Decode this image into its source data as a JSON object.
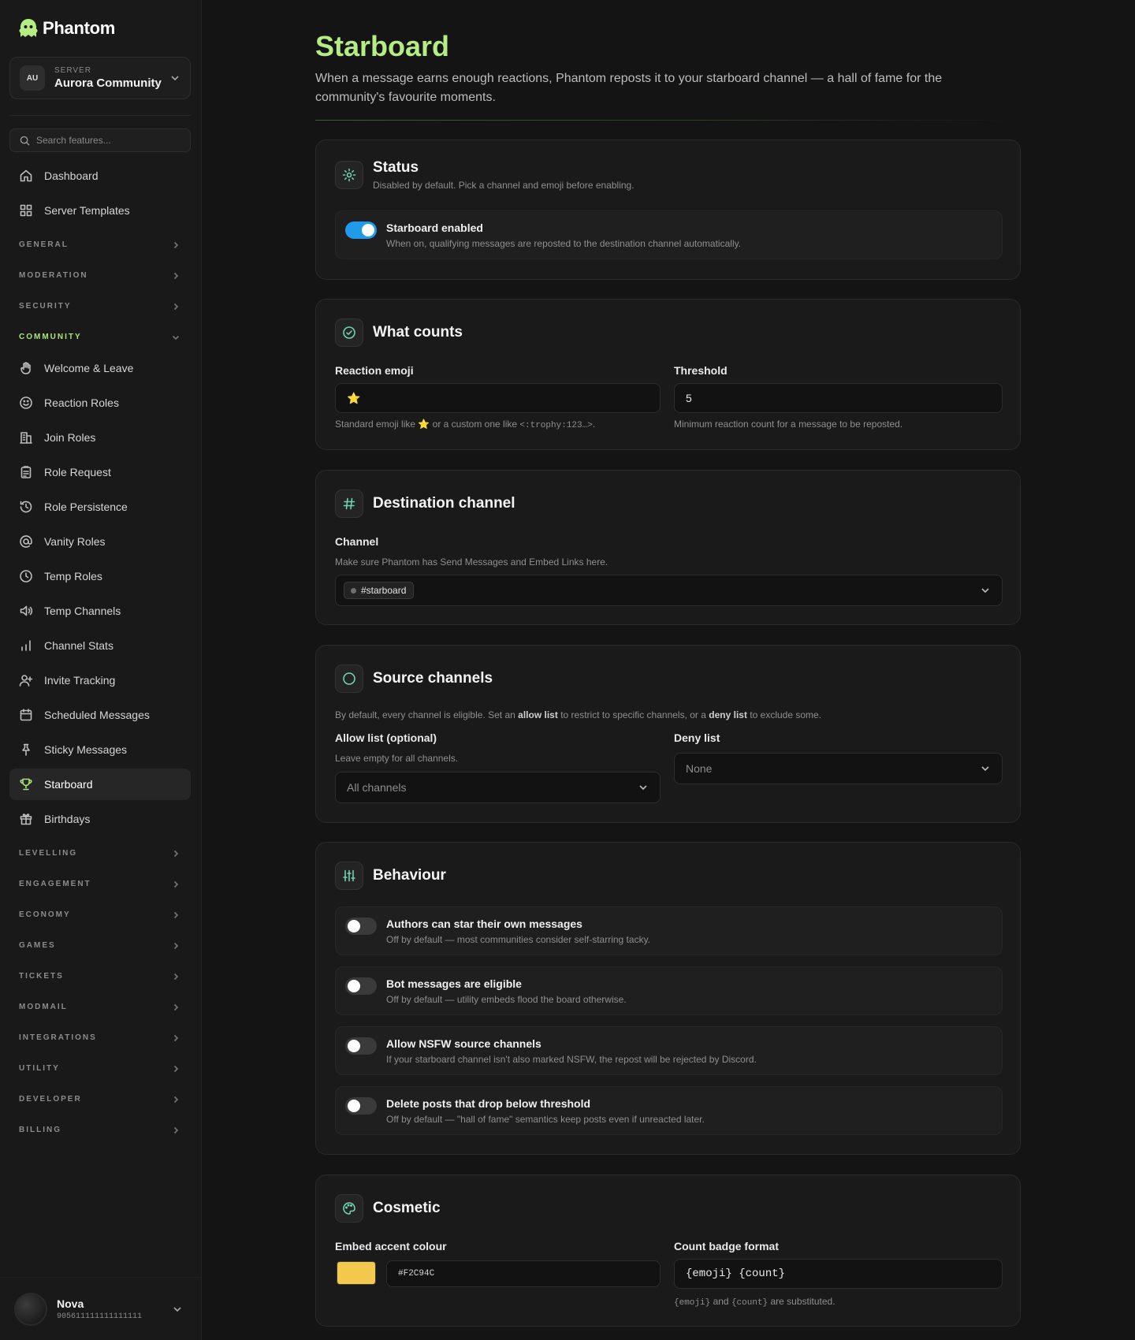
{
  "app": {
    "name": "Phantom"
  },
  "server": {
    "caption": "SERVER",
    "initials": "AU",
    "name": "Aurora Community"
  },
  "search": {
    "placeholder": "Search features..."
  },
  "nav": {
    "top": [
      {
        "label": "Dashboard",
        "icon": "home-icon"
      },
      {
        "label": "Server Templates",
        "icon": "grid-icon"
      }
    ],
    "sections_before": [
      "GENERAL",
      "MODERATION",
      "SECURITY"
    ],
    "open_section": "COMMUNITY",
    "community": [
      {
        "label": "Welcome & Leave",
        "icon": "hand-icon"
      },
      {
        "label": "Reaction Roles",
        "icon": "smile-icon"
      },
      {
        "label": "Join Roles",
        "icon": "building-icon"
      },
      {
        "label": "Role Request",
        "icon": "clipboard-icon"
      },
      {
        "label": "Role Persistence",
        "icon": "history-icon"
      },
      {
        "label": "Vanity Roles",
        "icon": "at-icon"
      },
      {
        "label": "Temp Roles",
        "icon": "clock-icon"
      },
      {
        "label": "Temp Channels",
        "icon": "speaker-icon"
      },
      {
        "label": "Channel Stats",
        "icon": "bar-chart-icon"
      },
      {
        "label": "Invite Tracking",
        "icon": "user-plus-icon"
      },
      {
        "label": "Scheduled Messages",
        "icon": "calendar-icon"
      },
      {
        "label": "Sticky Messages",
        "icon": "pin-icon"
      },
      {
        "label": "Starboard",
        "icon": "trophy-icon",
        "active": true
      },
      {
        "label": "Birthdays",
        "icon": "gift-icon"
      }
    ],
    "sections_after": [
      "LEVELLING",
      "ENGAGEMENT",
      "ECONOMY",
      "GAMES",
      "TICKETS",
      "MODMAIL",
      "INTEGRATIONS",
      "UTILITY",
      "DEVELOPER",
      "BILLING"
    ]
  },
  "user": {
    "name": "Nova",
    "id": "905611111111111111"
  },
  "page": {
    "title": "Starboard",
    "description": "When a message earns enough reactions, Phantom reposts it to your starboard channel — a hall of fame for the community's favourite moments."
  },
  "status": {
    "title": "Status",
    "subtitle": "Disabled by default. Pick a channel and emoji before enabling.",
    "toggle_title": "Starboard enabled",
    "toggle_sub": "When on, qualifying messages are reposted to the destination channel automatically.",
    "enabled": true
  },
  "counts": {
    "title": "What counts",
    "emoji_label": "Reaction emoji",
    "emoji_value": "⭐",
    "emoji_hint_a": "Standard emoji like ⭐ or a custom one like",
    "emoji_hint_code": "<:trophy:123…>",
    "emoji_hint_b": ".",
    "threshold_label": "Threshold",
    "threshold_value": "5",
    "threshold_hint": "Minimum reaction count for a message to be reposted."
  },
  "destination": {
    "title": "Destination channel",
    "label": "Channel",
    "hint": "Make sure Phantom has Send Messages and Embed Links here.",
    "value": "#starboard"
  },
  "source": {
    "title": "Source channels",
    "desc_a": "By default, every channel is eligible. Set an",
    "desc_b": "allow list",
    "desc_c": "to restrict to specific channels, or a",
    "desc_d": "deny list",
    "desc_e": "to exclude some.",
    "allow_label": "Allow list (optional)",
    "allow_hint": "Leave empty for all channels.",
    "allow_value": "All channels",
    "deny_label": "Deny list",
    "deny_value": "None"
  },
  "behaviour": {
    "title": "Behaviour",
    "items": [
      {
        "title": "Authors can star their own messages",
        "sub": "Off by default — most communities consider self-starring tacky.",
        "on": false
      },
      {
        "title": "Bot messages are eligible",
        "sub": "Off by default — utility embeds flood the board otherwise.",
        "on": false
      },
      {
        "title": "Allow NSFW source channels",
        "sub": "If your starboard channel isn't also marked NSFW, the repost will be rejected by Discord.",
        "on": false
      },
      {
        "title": "Delete posts that drop below threshold",
        "sub": "Off by default — \"hall of fame\" semantics keep posts even if unreacted later.",
        "on": false
      }
    ]
  },
  "cosmetic": {
    "title": "Cosmetic",
    "accent_label": "Embed accent colour",
    "accent_value": "#F2C94C",
    "badge_label": "Count badge format",
    "badge_value": "{emoji} {count}",
    "badge_hint_a": "{emoji}",
    "badge_hint_b": "and",
    "badge_hint_c": "{count}",
    "badge_hint_d": "are substituted."
  },
  "colors": {
    "accent": "#b5ec84",
    "toggle_on": "#1f9bea",
    "icon": "#6fd3b0"
  }
}
